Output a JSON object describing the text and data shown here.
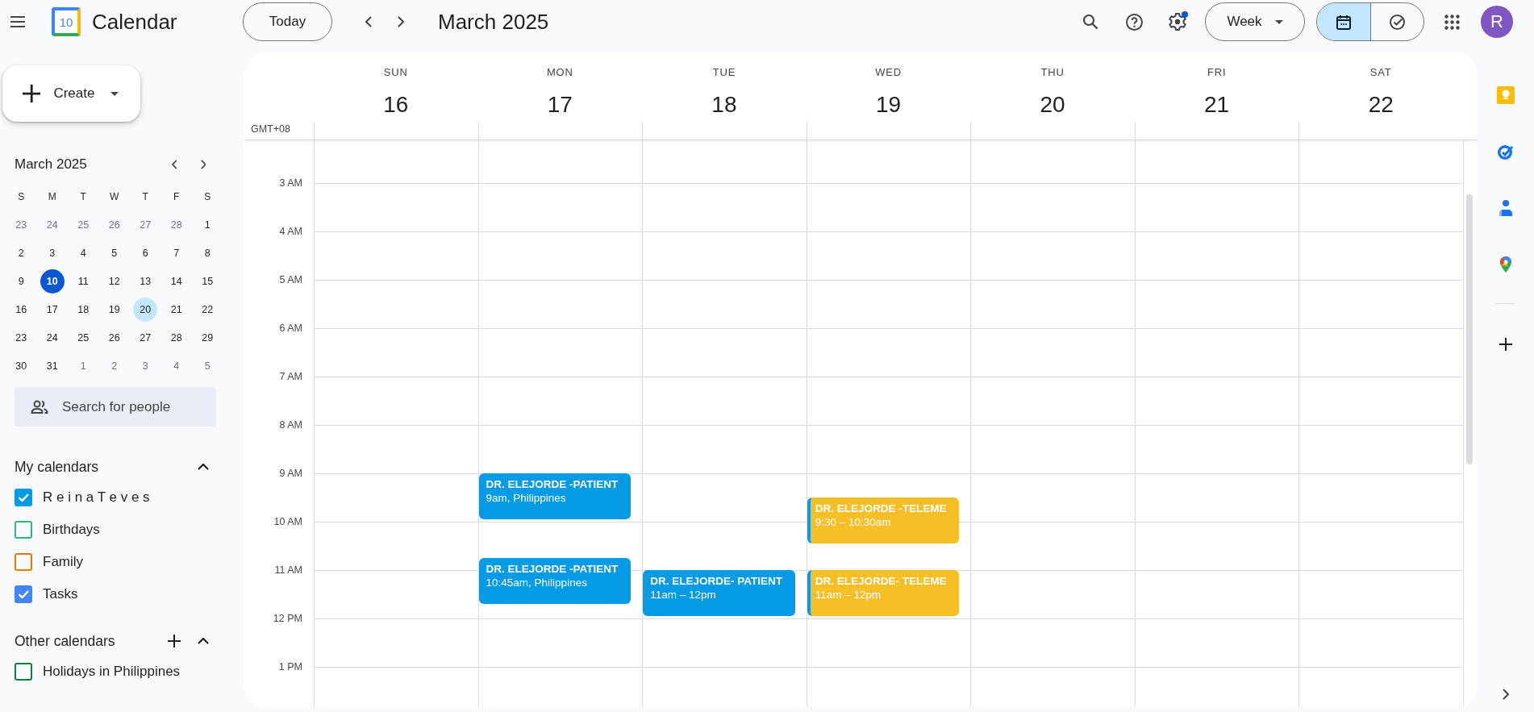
{
  "app": {
    "title": "Calendar",
    "logo_day": "10"
  },
  "toolbar": {
    "today": "Today",
    "title": "March 2025",
    "settings": {
      "badge": true
    },
    "view": "Week",
    "views": [
      {
        "kind": "calendar",
        "selected": true
      },
      {
        "kind": "tasks",
        "selected": false
      }
    ],
    "avatar": "R"
  },
  "sidebar": {
    "create": "Create",
    "mini_calendar": {
      "title": "March 2025",
      "weekdays": [
        "S",
        "M",
        "T",
        "W",
        "T",
        "F",
        "S"
      ],
      "weeks": [
        [
          {
            "d": "23",
            "outside": true,
            "today": false,
            "selected": false
          },
          {
            "d": "24",
            "outside": true,
            "today": false,
            "selected": false
          },
          {
            "d": "25",
            "outside": true,
            "today": false,
            "selected": false
          },
          {
            "d": "26",
            "outside": true,
            "today": false,
            "selected": false
          },
          {
            "d": "27",
            "outside": true,
            "today": false,
            "selected": false
          },
          {
            "d": "28",
            "outside": true,
            "today": false,
            "selected": false
          },
          {
            "d": "1",
            "outside": false,
            "today": false,
            "selected": false
          }
        ],
        [
          {
            "d": "2",
            "outside": false,
            "today": false,
            "selected": false
          },
          {
            "d": "3",
            "outside": false,
            "today": false,
            "selected": false
          },
          {
            "d": "4",
            "outside": false,
            "today": false,
            "selected": false
          },
          {
            "d": "5",
            "outside": false,
            "today": false,
            "selected": false
          },
          {
            "d": "6",
            "outside": false,
            "today": false,
            "selected": false
          },
          {
            "d": "7",
            "outside": false,
            "today": false,
            "selected": false
          },
          {
            "d": "8",
            "outside": false,
            "today": false,
            "selected": false
          }
        ],
        [
          {
            "d": "9",
            "outside": false,
            "today": false,
            "selected": false
          },
          {
            "d": "10",
            "outside": false,
            "today": true,
            "selected": false
          },
          {
            "d": "11",
            "outside": false,
            "today": false,
            "selected": false
          },
          {
            "d": "12",
            "outside": false,
            "today": false,
            "selected": false
          },
          {
            "d": "13",
            "outside": false,
            "today": false,
            "selected": false
          },
          {
            "d": "14",
            "outside": false,
            "today": false,
            "selected": false
          },
          {
            "d": "15",
            "outside": false,
            "today": false,
            "selected": false
          }
        ],
        [
          {
            "d": "16",
            "outside": false,
            "today": false,
            "selected": false
          },
          {
            "d": "17",
            "outside": false,
            "today": false,
            "selected": false
          },
          {
            "d": "18",
            "outside": false,
            "today": false,
            "selected": false
          },
          {
            "d": "19",
            "outside": false,
            "today": false,
            "selected": false
          },
          {
            "d": "20",
            "outside": false,
            "today": false,
            "selected": true
          },
          {
            "d": "21",
            "outside": false,
            "today": false,
            "selected": false
          },
          {
            "d": "22",
            "outside": false,
            "today": false,
            "selected": false
          }
        ],
        [
          {
            "d": "23",
            "outside": false,
            "today": false,
            "selected": false
          },
          {
            "d": "24",
            "outside": false,
            "today": false,
            "selected": false
          },
          {
            "d": "25",
            "outside": false,
            "today": false,
            "selected": false
          },
          {
            "d": "26",
            "outside": false,
            "today": false,
            "selected": false
          },
          {
            "d": "27",
            "outside": false,
            "today": false,
            "selected": false
          },
          {
            "d": "28",
            "outside": false,
            "today": false,
            "selected": false
          },
          {
            "d": "29",
            "outside": false,
            "today": false,
            "selected": false
          }
        ],
        [
          {
            "d": "30",
            "outside": false,
            "today": false,
            "selected": false
          },
          {
            "d": "31",
            "outside": false,
            "today": false,
            "selected": false
          },
          {
            "d": "1",
            "outside": true,
            "today": false,
            "selected": false
          },
          {
            "d": "2",
            "outside": true,
            "today": false,
            "selected": false
          },
          {
            "d": "3",
            "outside": true,
            "today": false,
            "selected": false
          },
          {
            "d": "4",
            "outside": true,
            "today": false,
            "selected": false
          },
          {
            "d": "5",
            "outside": true,
            "today": false,
            "selected": false
          }
        ]
      ]
    },
    "search": {
      "placeholder": "Search for people"
    },
    "sections": [
      {
        "title": "My calendars",
        "expanded": true,
        "addable": false,
        "items": [
          {
            "label": "R e i n a T e v e s",
            "checked": true,
            "color": "#039be5"
          },
          {
            "label": "Birthdays",
            "checked": false,
            "color": "#33b679"
          },
          {
            "label": "Family",
            "checked": false,
            "color": "#e67c00"
          },
          {
            "label": "Tasks",
            "checked": true,
            "color": "#4285f4"
          }
        ]
      },
      {
        "title": "Other calendars",
        "expanded": true,
        "addable": true,
        "items": [
          {
            "label": "Holidays in Philippines",
            "checked": false,
            "color": "#0b8043"
          }
        ]
      }
    ]
  },
  "week": {
    "timezone": "GMT+08",
    "hours": [
      "3 AM",
      "4 AM",
      "5 AM",
      "6 AM",
      "7 AM",
      "8 AM",
      "9 AM",
      "10 AM",
      "11 AM",
      "12 PM",
      "1 PM"
    ],
    "days": [
      {
        "name": "SUN",
        "date": "16"
      },
      {
        "name": "MON",
        "date": "17",
        "events": [
          {
            "title": "DR. ELEJORDE -PATIENT",
            "time": "9am, Philippines",
            "color": "#039be5",
            "kind": "plain"
          },
          {
            "title": "DR. ELEJORDE -PATIENT",
            "time": "10:45am, Philippines",
            "color": "#039be5",
            "kind": "plain"
          }
        ]
      },
      {
        "name": "TUE",
        "date": "18",
        "events": [
          {
            "title": "DR. ELEJORDE- PATIENT",
            "time": "11am – 12pm",
            "color": "#039be5",
            "kind": "plain"
          }
        ]
      },
      {
        "name": "WED",
        "date": "19",
        "events": [
          {
            "title": "DR. ELEJORDE -TELEME",
            "time": "9:30 – 10:30am",
            "color": "#f6bf26",
            "kind": "recolored"
          },
          {
            "title": "DR. ELEJORDE- TELEME",
            "time": "11am – 12pm",
            "color": "#f6bf26",
            "kind": "recolored"
          }
        ]
      },
      {
        "name": "THU",
        "date": "20"
      },
      {
        "name": "FRI",
        "date": "21"
      },
      {
        "name": "SAT",
        "date": "22"
      }
    ]
  }
}
